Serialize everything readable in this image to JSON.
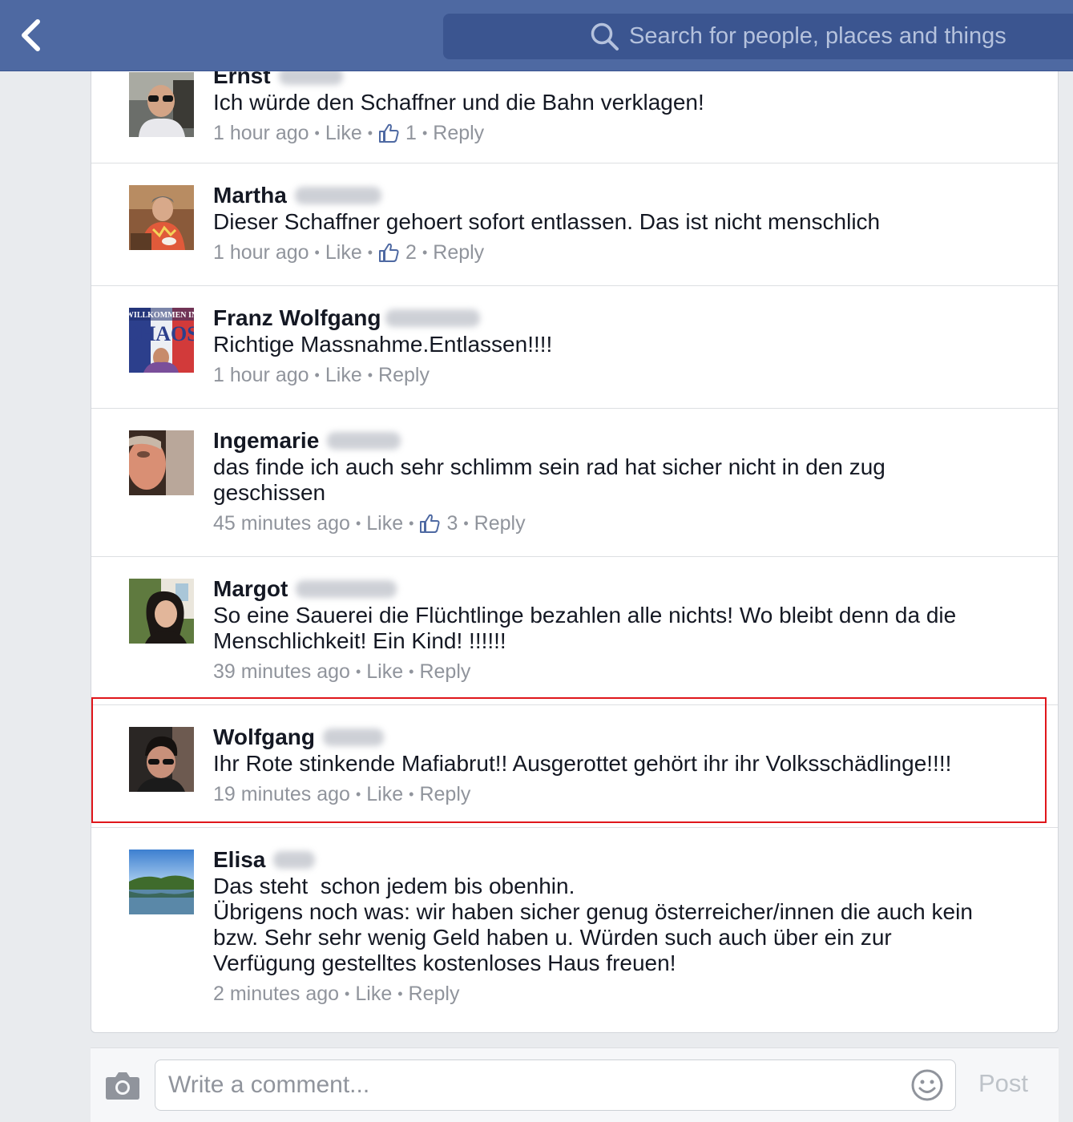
{
  "header": {
    "back_icon": "chevron-left-icon",
    "search_placeholder": "Search for people, places and things",
    "search_icon": "search-icon",
    "bar_color": "#4e69a2"
  },
  "comments": [
    {
      "name": "Ernst",
      "text": "Ich würde den Schaffner und die Bahn verklagen!",
      "time": "1 hour ago",
      "like_label": "Like",
      "like_count": "1",
      "reply_label": "Reply"
    },
    {
      "name": "Martha",
      "text": "Dieser Schaffner gehoert sofort entlassen. Das ist nicht menschlich",
      "time": "1 hour ago",
      "like_label": "Like",
      "like_count": "2",
      "reply_label": "Reply"
    },
    {
      "name": "Franz Wolfgang",
      "text": "Richtige Massnahme.Entlassen!!!!",
      "time": "1 hour ago",
      "like_label": "Like",
      "reply_label": "Reply",
      "avatar_text": "WILLKOMMEN IN CHAOS"
    },
    {
      "name": "Ingemarie",
      "text": "das finde ich auch sehr schlimm sein rad hat sicher nicht in den zug\ngeschissen",
      "time": "45 minutes ago",
      "like_label": "Like",
      "like_count": "3",
      "reply_label": "Reply"
    },
    {
      "name": "Margot",
      "text": "So eine Sauerei die Flüchtlinge bezahlen alle nichts! Wo bleibt denn da die\nMenschlichkeit! Ein Kind! !!!!!!",
      "time": "39 minutes ago",
      "like_label": "Like",
      "reply_label": "Reply"
    },
    {
      "name": "Wolfgang",
      "text": "Ihr Rote stinkende Mafiabrut!! Ausgerottet gehört ihr ihr Volksschädlinge!!!!",
      "time": "19 minutes ago",
      "like_label": "Like",
      "reply_label": "Reply",
      "highlighted": true,
      "highlight_color": "#e0161b"
    },
    {
      "name": "Elisa",
      "text": "Das steht  schon jedem bis obenhin.\nÜbrigens noch was: wir haben sicher genug österreicher/innen die auch kein\nbzw. Sehr sehr wenig Geld haben u. Würden such auch über ein zur\nVerfügung gestelltes kostenloses Haus freuen!",
      "time": "2 minutes ago",
      "like_label": "Like",
      "reply_label": "Reply"
    }
  ],
  "composer": {
    "camera_icon": "camera-icon",
    "placeholder": "Write a comment...",
    "emoji_icon": "smiley-icon",
    "post_label": "Post"
  }
}
